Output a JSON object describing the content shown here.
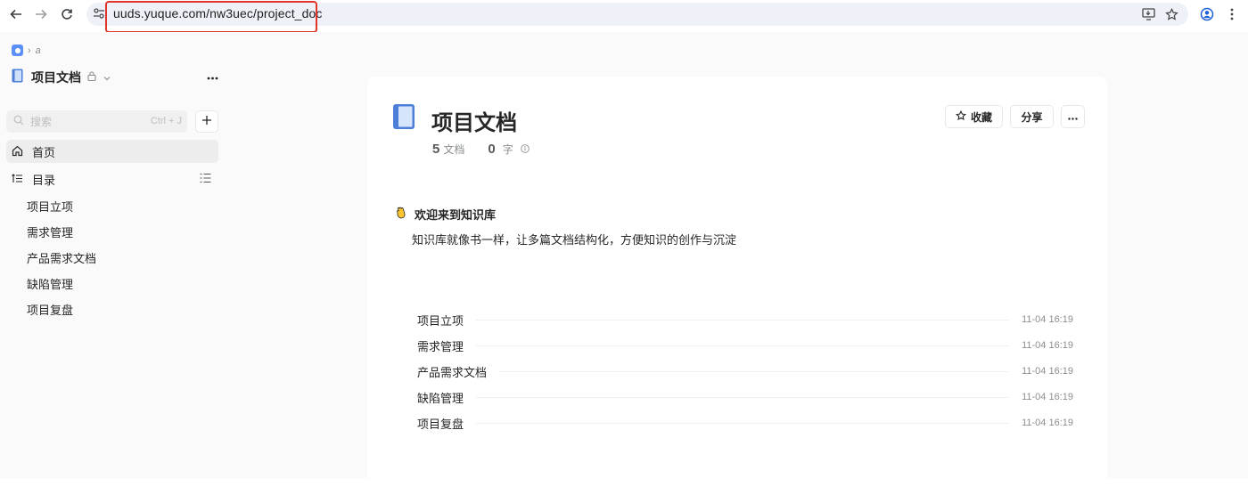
{
  "browser": {
    "url": "uuds.yuque.com/nw3uec/project_doc"
  },
  "sidebar": {
    "breadcrumb_text": "a",
    "book_title": "项目文档",
    "search_placeholder": "搜索",
    "search_shortcut": "Ctrl + J",
    "home_label": "首页",
    "toc_label": "目录",
    "toc_items": [
      "项目立项",
      "需求管理",
      "产品需求文档",
      "缺陷管理",
      "项目复盘"
    ]
  },
  "main": {
    "title": "项目文档",
    "doc_count": "5",
    "doc_unit": "文档",
    "word_count": "0",
    "word_unit": "字",
    "collect_label": "收藏",
    "share_label": "分享",
    "welcome_title": "欢迎来到知识库",
    "welcome_desc": "知识库就像书一样，让多篇文档结构化，方便知识的创作与沉淀",
    "docs": [
      {
        "name": "项目立项",
        "time": "11-04 16:19"
      },
      {
        "name": "需求管理",
        "time": "11-04 16:19"
      },
      {
        "name": "产品需求文档",
        "time": "11-04 16:19"
      },
      {
        "name": "缺陷管理",
        "time": "11-04 16:19"
      },
      {
        "name": "项目复盘",
        "time": "11-04 16:19"
      }
    ]
  }
}
